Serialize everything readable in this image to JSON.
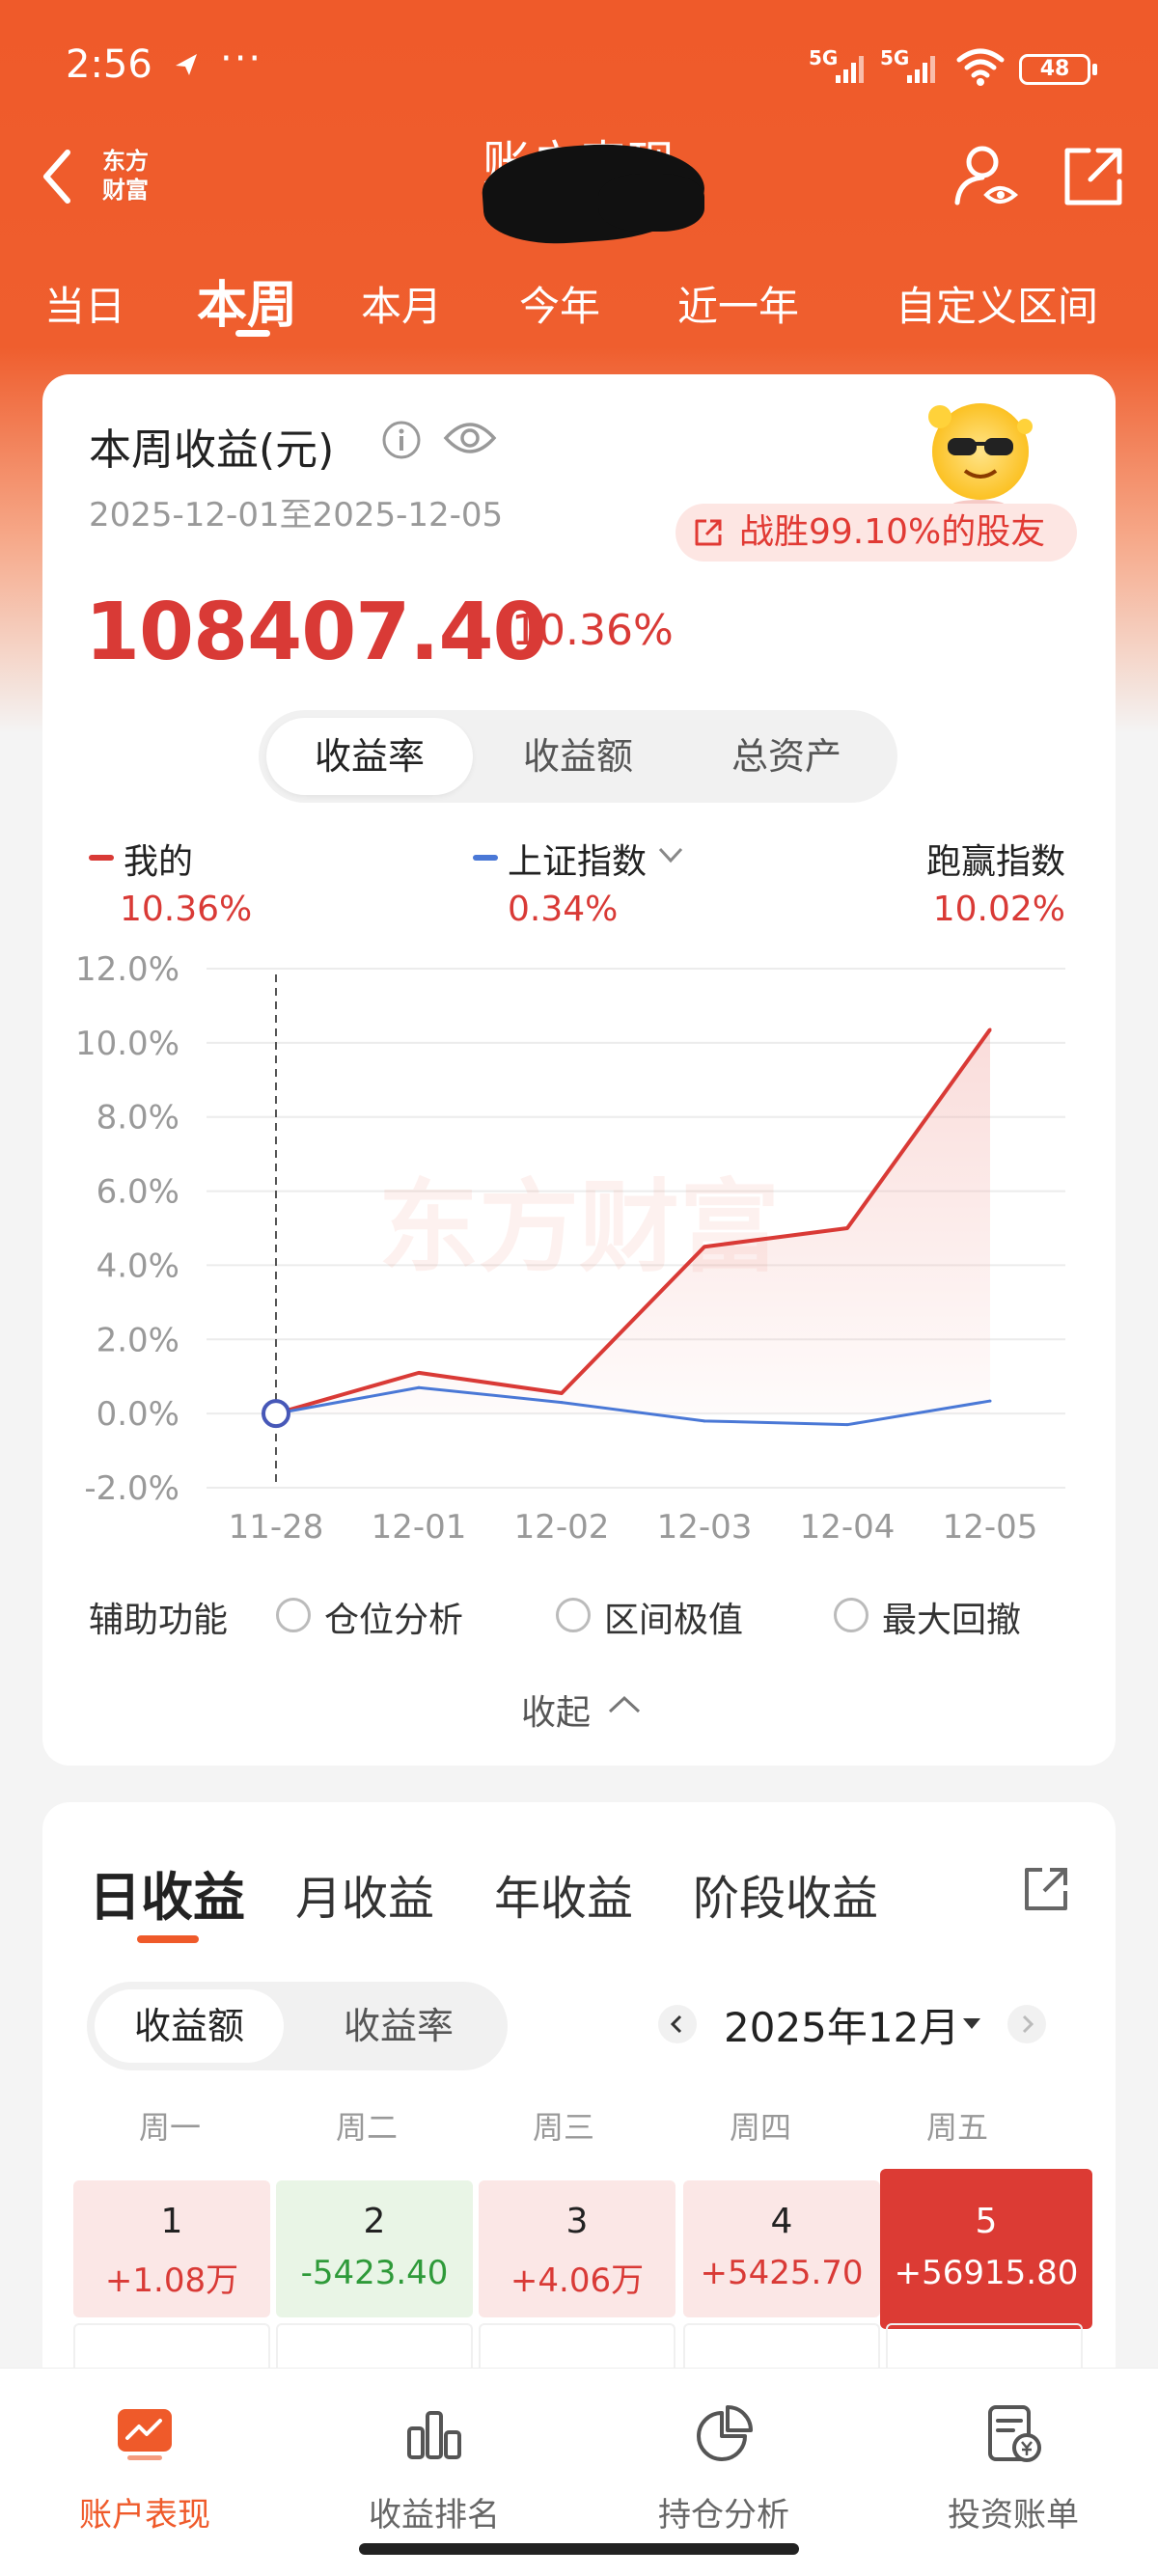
{
  "status_bar": {
    "time": "2:56",
    "dots": "···",
    "sig1": "5G",
    "sig2": "5G",
    "battery": "48"
  },
  "nav": {
    "brand": [
      "东方",
      "财富"
    ],
    "title": "账户表现"
  },
  "period_tabs": [
    "当日",
    "本周",
    "本月",
    "今年",
    "近一年",
    "自定义区间"
  ],
  "summary": {
    "title": "本周收益(元)",
    "range": "2025-12-01至2025-12-05",
    "beat": "战胜99.10%的股友",
    "profit": "108407.40",
    "profit_pct": "10.36%"
  },
  "metric_tabs": [
    "收益率",
    "收益额",
    "总资产"
  ],
  "legend": {
    "mine_label": "我的",
    "mine_value": "10.36%",
    "index_label": "上证指数",
    "index_value": "0.34%",
    "beat_label": "跑赢指数",
    "beat_value": "10.02%"
  },
  "chart_data": {
    "type": "line",
    "x": [
      "11-28",
      "12-01",
      "12-02",
      "12-03",
      "12-04",
      "12-05"
    ],
    "ylim": [
      -2.0,
      12.0
    ],
    "yticks": [
      "12.0%",
      "10.0%",
      "8.0%",
      "6.0%",
      "4.0%",
      "2.0%",
      "0.0%",
      "-2.0%"
    ],
    "watermark": "东方财富",
    "series": [
      {
        "name": "我的",
        "color": "#d93a36",
        "values": [
          0.0,
          1.1,
          0.55,
          4.5,
          5.0,
          10.36
        ]
      },
      {
        "name": "上证指数",
        "color": "#4a78d6",
        "values": [
          0.0,
          0.7,
          0.3,
          -0.2,
          -0.3,
          0.34
        ]
      }
    ]
  },
  "aux": {
    "label": "辅助功能",
    "options": [
      "仓位分析",
      "区间极值",
      "最大回撤"
    ],
    "collapse": "收起"
  },
  "returns": {
    "tabs": [
      "日收益",
      "月收益",
      "年收益",
      "阶段收益"
    ],
    "sub_tabs": [
      "收益额",
      "收益率"
    ],
    "month": "2025年12月",
    "weekdays": [
      "周一",
      "周二",
      "周三",
      "周四",
      "周五"
    ],
    "days": [
      {
        "day": "1",
        "value": "+1.08万"
      },
      {
        "day": "2",
        "value": "-5423.40"
      },
      {
        "day": "3",
        "value": "+4.06万"
      },
      {
        "day": "4",
        "value": "+5425.70"
      },
      {
        "day": "5",
        "value": "+56915.80"
      }
    ]
  },
  "bottom_nav": [
    "账户表现",
    "收益排名",
    "持仓分析",
    "投资账单"
  ]
}
